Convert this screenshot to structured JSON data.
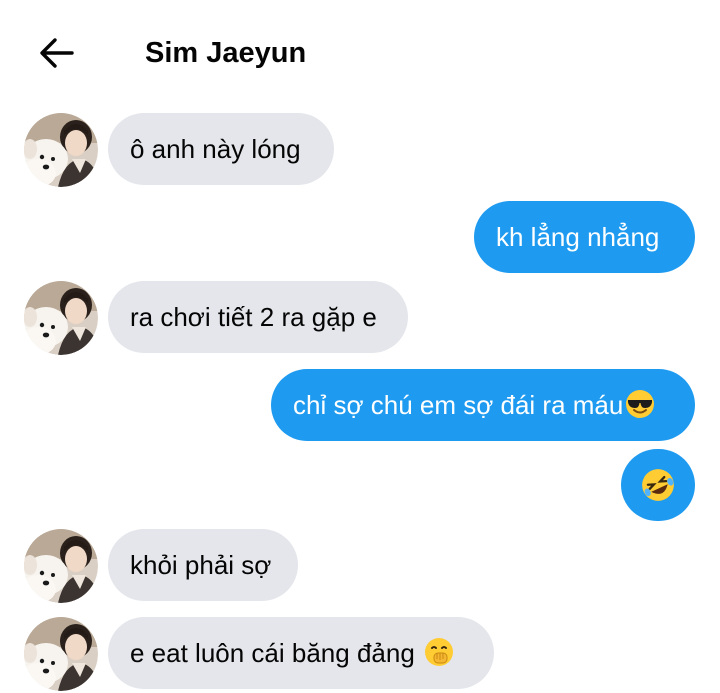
{
  "header": {
    "back_icon": "arrow-left-icon",
    "title": "Sim Jaeyun"
  },
  "colors": {
    "outgoing_bubble": "#1e9bf0",
    "incoming_bubble": "#e4e6eb",
    "text": "#050505"
  },
  "messages": [
    {
      "sender": "them",
      "text": "ô anh này lóng",
      "emoji": null,
      "avatar": true
    },
    {
      "sender": "me",
      "text": "kh lẳng nhẳng",
      "emoji": null
    },
    {
      "sender": "them",
      "text": "ra chơi tiết 2 ra gặp e",
      "emoji": null,
      "avatar": true
    },
    {
      "sender": "me",
      "text": "chỉ sợ chú em sợ đái ra máu",
      "emoji": "sunglasses-face-emoji"
    },
    {
      "sender": "me",
      "text": "",
      "emoji": "rolling-on-floor-laughing-emoji"
    },
    {
      "sender": "them",
      "text": "khỏi phải sợ",
      "emoji": null,
      "avatar": true
    },
    {
      "sender": "them",
      "text": "e eat luôn cái băng đảng ",
      "emoji": "hand-over-mouth-emoji",
      "avatar": true
    }
  ]
}
